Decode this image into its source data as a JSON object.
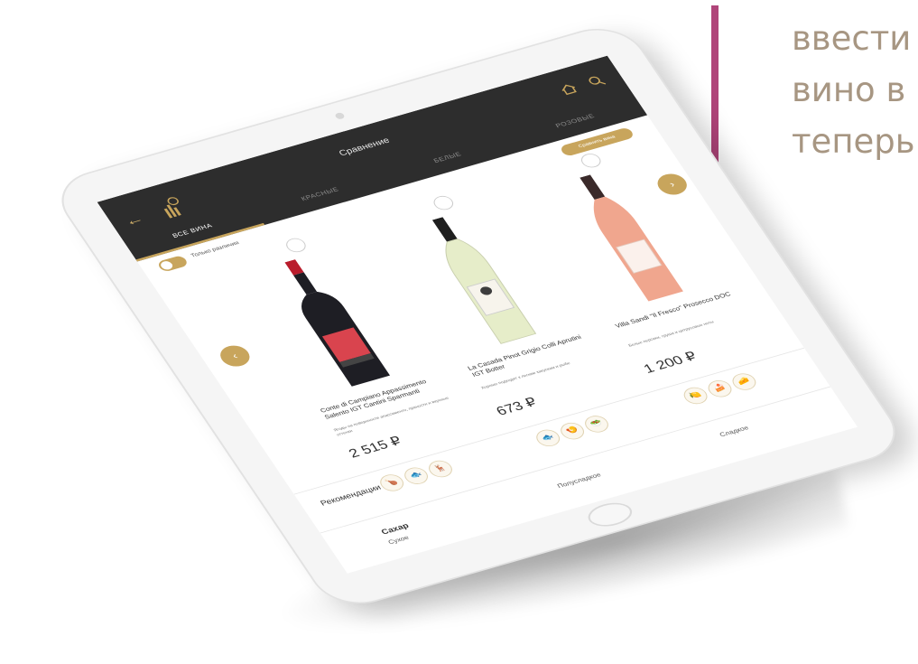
{
  "quote": {
    "lines": [
      "ввести",
      "вино в",
      "теперь"
    ],
    "accent_color": "#b0457a",
    "text_color": "#a79682"
  },
  "app": {
    "title": "Сравнение",
    "back_icon": "arrow-left-icon",
    "logo_icon": "wine-logo-icon",
    "home_icon": "home-icon",
    "search_icon": "search-icon",
    "tabs": [
      {
        "label": "ВСЕ ВИНА",
        "active": true
      },
      {
        "label": "КРАСНЫЕ",
        "active": false
      },
      {
        "label": "БЕЛЫЕ",
        "active": false
      },
      {
        "label": "РОЗОВЫЕ",
        "active": false
      }
    ],
    "compare_button": "Сравнить вина",
    "toggle_label": "Только различия",
    "accent_color": "#c8a55c",
    "header_color": "#2d2d2d"
  },
  "products": [
    {
      "name": "Conte di Campiano Appassimento Salento IGT Cantini Sparmanti",
      "desc": "Ягоды на поверхности апассименто, пряности и вкусные оттенки",
      "price": "2 515 ₽",
      "bottle": "red",
      "foods": [
        "🍗",
        "🐟",
        "🦌"
      ]
    },
    {
      "name": "La Casada Pinot Grigio Colli Aprutini IGT Botter",
      "desc": "Хорошо подходит к легким закускам и рыбе",
      "price": "673 ₽",
      "bottle": "white",
      "foods": [
        "🐟",
        "🍤",
        "🥗"
      ]
    },
    {
      "name": "Villa Sandi \"Il Fresco\" Prosecco DOC",
      "desc": "Белые персики, груша и цитрусовые ноты",
      "price": "1 200 ₽",
      "bottle": "rose",
      "foods": [
        "🍋",
        "🍰",
        "🧀"
      ]
    }
  ],
  "recommendations": {
    "title": "Рекомендации"
  },
  "sugar": {
    "label": "Сахар",
    "values": [
      "Сухое",
      "Полусладкое",
      "Сладкое"
    ]
  }
}
